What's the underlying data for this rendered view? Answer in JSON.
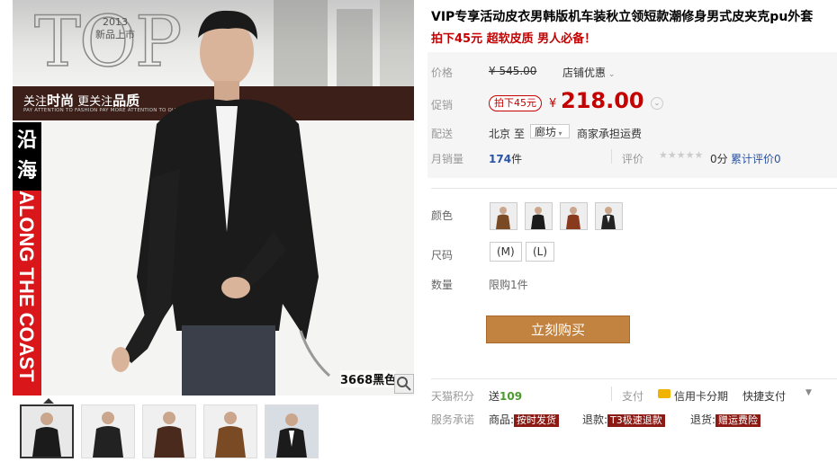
{
  "gallery": {
    "banner_top": "TOP",
    "banner_year": "2013",
    "banner_new": "新品上市",
    "band_main_a": "关注",
    "band_main_b": "时尚",
    "band_main_c": " 更关注",
    "band_main_d": "品质",
    "band_sub": "PAY ATTENTION TO FASHION PAY MORE ATTENTION TO QUALITY",
    "brand_cn": "沿海",
    "brand_en": "ALONG THE COAST",
    "sku_label": "3668黑色"
  },
  "product": {
    "title": "VIP专享活动皮衣男韩版机车装秋立领短款潮修身男式皮夹克pu外套",
    "subtitle": "拍下45元 超软皮质 男人必备！",
    "price_label": "价格",
    "original_price": "¥ 545.00",
    "shop_discount": "店铺优惠",
    "promo_label": "促销",
    "promo_tag": "拍下45元",
    "currency": "¥",
    "promo_price": "218.00",
    "delivery_label": "配送",
    "from_city": "北京",
    "to": "至",
    "to_city": "廊坊",
    "shipping_note": "商家承担运费",
    "sales_label": "月销量",
    "sales_count": "174",
    "sales_unit": "件",
    "rating_label": "评价",
    "rating_score": "0分",
    "reviews_text": "累计评价",
    "reviews_count": "0",
    "color_label": "颜色",
    "size_label": "尺码",
    "sizes": [
      "(M)",
      "(L)"
    ],
    "qty_label": "数量",
    "qty_limit": "限购1件",
    "buy_button": "立刻购买",
    "points_label": "天猫积分",
    "points_text": "送",
    "points_value": "109",
    "pay_label": "支付",
    "credit_text": "信用卡分期",
    "quick_pay": "快捷支付",
    "service_label": "服务承诺",
    "goods_label": "商品:",
    "goods_tag": "按时发货",
    "refund_label": "退款:",
    "refund_tag": "T3极速退款",
    "return_label": "退货:",
    "return_tag": "赠运费险"
  },
  "colors": {
    "accent_red": "#c40000",
    "buy_button": "#c28240",
    "band": "#3b1f18"
  }
}
